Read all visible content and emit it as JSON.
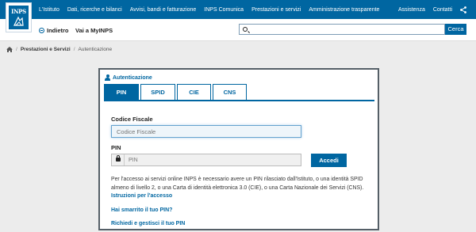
{
  "logo": {
    "text": "INPS"
  },
  "topnav": {
    "items": [
      {
        "label": "L'Istituto"
      },
      {
        "label": "Dati, ricerche e bilanci"
      },
      {
        "label": "Avvisi, bandi e fatturazione"
      },
      {
        "label": "INPS Comunica"
      },
      {
        "label": "Prestazioni e servizi"
      },
      {
        "label": "Amministrazione trasparente"
      }
    ],
    "right": {
      "assistenza": "Assistenza",
      "contatti": "Contatti"
    }
  },
  "secbar": {
    "back_label": "Indietro",
    "myinps_label": "Vai a MyINPS",
    "search": {
      "placeholder": "",
      "button_label": "Cerca"
    }
  },
  "breadcrumb": {
    "items": [
      {
        "label": "Prestazioni e Servizi"
      },
      {
        "label": "Autenticazione"
      }
    ],
    "separator": "/"
  },
  "panel": {
    "title": "Autenticazione",
    "tabs": [
      {
        "label": "PIN"
      },
      {
        "label": "SPID"
      },
      {
        "label": "CIE"
      },
      {
        "label": "CNS"
      }
    ],
    "codice_fiscale": {
      "label": "Codice Fiscale",
      "placeholder": "Codice Fiscale"
    },
    "pin": {
      "label": "PIN",
      "placeholder": "PIN"
    },
    "submit_label": "Accedi",
    "info_text": "Per l'accesso ai servizi online INPS è necessario avere un PIN rilasciato dall'Istituto, o una identità SPID almeno di livello 2, o una Carta di identità elettronica 3.0 (CIE), o una Carta Nazionale dei Servizi (CNS).",
    "links": [
      {
        "label": "Istruzioni per l'accesso"
      },
      {
        "label": "Hai smarrito il tuo PIN?"
      },
      {
        "label": "Richiedi e gestisci il tuo PIN"
      }
    ]
  },
  "colors": {
    "brand": "#0066a1",
    "panel_border": "#555f67",
    "background": "#ececec"
  }
}
